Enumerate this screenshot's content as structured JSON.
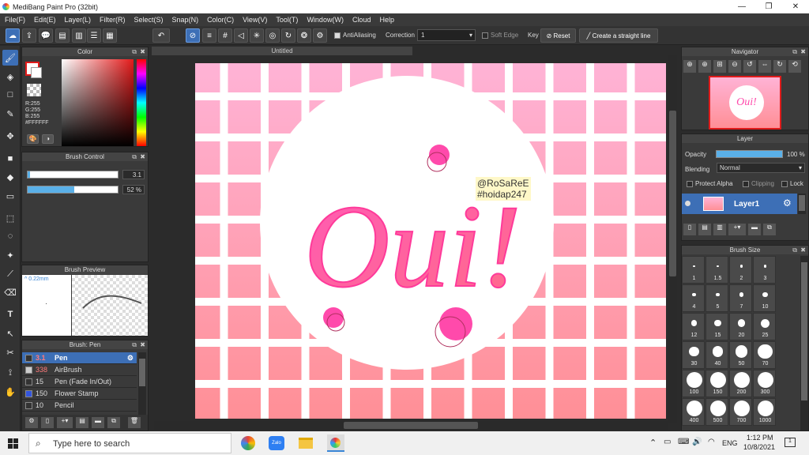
{
  "window": {
    "title": "MediBang Paint Pro (32bit)"
  },
  "menu": [
    "File(F)",
    "Edit(E)",
    "Layer(L)",
    "Filter(R)",
    "Select(S)",
    "Snap(N)",
    "Color(C)",
    "View(V)",
    "Tool(T)",
    "Window(W)",
    "Cloud",
    "Help"
  ],
  "toolbar": {
    "antialiasing": "AntiAliasing",
    "correction_label": "Correction",
    "correction_value": "1",
    "soft_edge": "Soft Edge",
    "key_label": "Key",
    "reset": "Reset",
    "straight_line": "Create a straight line"
  },
  "color_panel": {
    "title": "Color",
    "r": "R:255",
    "g": "G:255",
    "b": "B:255",
    "hex": "#FFFFFF",
    "primary": "#e01b1b",
    "secondary": "#ffffff"
  },
  "brush_control": {
    "title": "Brush Control",
    "size": "3.1",
    "opacity": "52 %",
    "opacity_fraction": 0.52
  },
  "brush_preview": {
    "title": "Brush Preview",
    "size": "0.22mm"
  },
  "brush_list": {
    "title": "Brush: Pen",
    "items": [
      {
        "size": "3.1",
        "name": "Pen",
        "color": "#333333",
        "selected": true
      },
      {
        "size": "338",
        "name": "AirBrush",
        "color": "#cccccc",
        "selected": false
      },
      {
        "size": "15",
        "name": "Pen (Fade In/Out)",
        "color": "#333333",
        "selected": false
      },
      {
        "size": "150",
        "name": "Flower Stamp",
        "color": "#3355dd",
        "selected": false
      },
      {
        "size": "10",
        "name": "Pencil",
        "color": "#333333",
        "selected": false
      }
    ]
  },
  "document": {
    "tab": "Untitled"
  },
  "artwork": {
    "text": "Oui!",
    "credit_1": "@RoSaReE",
    "credit_2": "#hoidap247"
  },
  "navigator": {
    "title": "Navigator"
  },
  "layer_panel": {
    "title": "Layer",
    "opacity_label": "Opacity",
    "opacity_value": "100 %",
    "blending_label": "Blending",
    "blending_value": "Normal",
    "protect_alpha": "Protect Alpha",
    "clipping": "Clipping",
    "lock": "Lock",
    "layer_name": "Layer1"
  },
  "brush_size": {
    "title": "Brush Size",
    "sizes": [
      "1",
      "1.5",
      "2",
      "3",
      "4",
      "5",
      "7",
      "10",
      "12",
      "15",
      "20",
      "25",
      "30",
      "40",
      "50",
      "70",
      "100",
      "150",
      "200",
      "300",
      "400",
      "500",
      "700",
      "1000"
    ]
  },
  "taskbar": {
    "search_placeholder": "Type here to search",
    "lang": "ENG",
    "time": "1:12 PM",
    "date": "10/8/2021",
    "notif": "1"
  }
}
